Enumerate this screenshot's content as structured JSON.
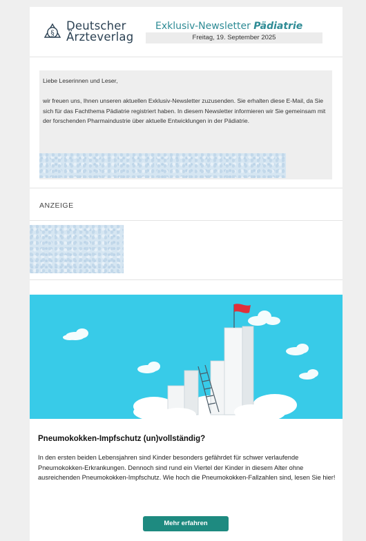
{
  "header": {
    "logo_line1": "Deutscher",
    "logo_line2": "Ärzteverlag",
    "newsletter_title_prefix": "Exklusiv-Newsletter",
    "newsletter_title_topic": "Pädiatrie",
    "date": "Freitag, 19. September 2025"
  },
  "intro": {
    "greeting": "Liebe Leserinnen und Leser,",
    "paragraph": "wir freuen uns, Ihnen unseren aktuellen Exklusiv-Newsletter zuzusenden. Sie erhalten diese E-Mail, da Sie sich für das Fachthema Pädiatrie registriert haben. In diesem Newsletter informieren wir Sie gemeinsam mit der forschenden Pharmaindustrie über aktuelle Entwicklungen in der Pädiatrie."
  },
  "ad": {
    "label": "ANZEIGE"
  },
  "article": {
    "title": "Pneumokokken-Impfschutz (un)vollständig?",
    "text": "In den ersten beiden Lebensjahren sind Kinder besonders gefährdet für schwer verlaufende Pneumokokken-Erkrankungen. Dennoch sind rund ein Viertel der Kinder in diesem Alter ohne ausreichenden Pneumokokken-Impfschutz. Wie hoch die Pneumokokken-Fallzahlen sind, lesen Sie hier!",
    "button_label": "Mehr erfahren"
  },
  "colors": {
    "accent_teal": "#2e8b95",
    "button": "#1e8a80",
    "hero_sky": "#38cbe8"
  }
}
